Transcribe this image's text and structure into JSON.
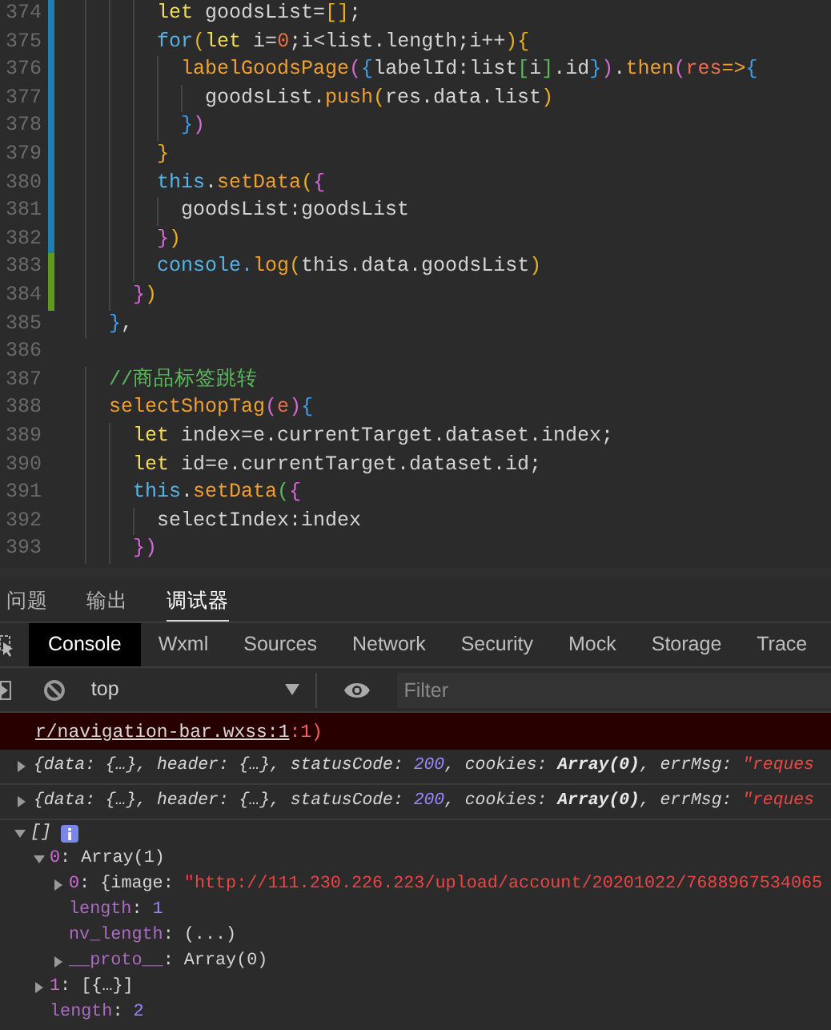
{
  "editor": {
    "lines": [
      {
        "number": "374",
        "modified": true,
        "added": false,
        "tokens": [
          {
            "t": "      let",
            "kind": "decl"
          },
          {
            "t": " goodsList=",
            "kind": "plain"
          },
          {
            "t": "[]",
            "kind": "b1"
          },
          {
            "t": ";",
            "kind": "plain"
          }
        ]
      },
      {
        "number": "375",
        "modified": true,
        "added": false,
        "tokens": [
          {
            "t": "      for",
            "kind": "kw"
          },
          {
            "t": "(",
            "kind": "b1"
          },
          {
            "t": "let",
            "kind": "decl"
          },
          {
            "t": " i=",
            "kind": "plain"
          },
          {
            "t": "0",
            "kind": "num"
          },
          {
            "t": ";i<list.length;i++",
            "kind": "plain"
          },
          {
            "t": "){",
            "kind": "b1"
          }
        ]
      },
      {
        "number": "376",
        "modified": true,
        "added": false,
        "tokens": [
          {
            "t": "        labelGoodsPage",
            "kind": "fn"
          },
          {
            "t": "(",
            "kind": "b2"
          },
          {
            "t": "{",
            "kind": "b3"
          },
          {
            "t": "labelId:list",
            "kind": "plain"
          },
          {
            "t": "[",
            "kind": "b4"
          },
          {
            "t": "i",
            "kind": "plain"
          },
          {
            "t": "]",
            "kind": "b4"
          },
          {
            "t": ".id",
            "kind": "plain"
          },
          {
            "t": "}",
            "kind": "b3"
          },
          {
            "t": ")",
            "kind": "b2"
          },
          {
            "t": ".",
            "kind": "plain"
          },
          {
            "t": "then",
            "kind": "fn"
          },
          {
            "t": "(",
            "kind": "b2"
          },
          {
            "t": "res",
            "kind": "param"
          },
          {
            "t": "=>",
            "kind": "fn"
          },
          {
            "t": "{",
            "kind": "b3"
          }
        ]
      },
      {
        "number": "377",
        "modified": true,
        "added": false,
        "tokens": [
          {
            "t": "          goodsList.",
            "kind": "plain"
          },
          {
            "t": "push",
            "kind": "fn"
          },
          {
            "t": "(",
            "kind": "b1"
          },
          {
            "t": "res.data.list",
            "kind": "plain"
          },
          {
            "t": ")",
            "kind": "b1"
          }
        ]
      },
      {
        "number": "378",
        "modified": true,
        "added": false,
        "tokens": [
          {
            "t": "        }",
            "kind": "b3"
          },
          {
            "t": ")",
            "kind": "b2"
          }
        ]
      },
      {
        "number": "379",
        "modified": true,
        "added": false,
        "tokens": [
          {
            "t": "      }",
            "kind": "b1"
          }
        ]
      },
      {
        "number": "380",
        "modified": true,
        "added": false,
        "tokens": [
          {
            "t": "      this",
            "kind": "kw"
          },
          {
            "t": ".",
            "kind": "plain"
          },
          {
            "t": "setData",
            "kind": "fn"
          },
          {
            "t": "(",
            "kind": "b1"
          },
          {
            "t": "{",
            "kind": "b2"
          }
        ]
      },
      {
        "number": "381",
        "modified": true,
        "added": false,
        "tokens": [
          {
            "t": "        goodsList:goodsList",
            "kind": "plain"
          }
        ]
      },
      {
        "number": "382",
        "modified": true,
        "added": false,
        "tokens": [
          {
            "t": "      }",
            "kind": "b2"
          },
          {
            "t": ")",
            "kind": "b1"
          }
        ]
      },
      {
        "number": "383",
        "modified": false,
        "added": true,
        "tokens": [
          {
            "t": "      console.",
            "kind": "kw"
          },
          {
            "t": "log",
            "kind": "fn"
          },
          {
            "t": "(",
            "kind": "b1"
          },
          {
            "t": "this.data.goodsList",
            "kind": "plain"
          },
          {
            "t": ")",
            "kind": "b1"
          }
        ]
      },
      {
        "number": "384",
        "modified": false,
        "added": true,
        "tokens": [
          {
            "t": "    }",
            "kind": "b2"
          },
          {
            "t": ")",
            "kind": "b1"
          }
        ]
      },
      {
        "number": "385",
        "modified": false,
        "added": false,
        "tokens": [
          {
            "t": "  }",
            "kind": "b3"
          },
          {
            "t": ",",
            "kind": "plain"
          }
        ]
      },
      {
        "number": "386",
        "modified": false,
        "added": false
      },
      {
        "number": "387",
        "modified": false,
        "added": false,
        "tokens": [
          {
            "t": "  //商品标签跳转",
            "kind": "comment"
          }
        ]
      },
      {
        "number": "388",
        "modified": false,
        "added": false,
        "tokens": [
          {
            "t": "  selectShopTag",
            "kind": "fn"
          },
          {
            "t": "(",
            "kind": "b2"
          },
          {
            "t": "e",
            "kind": "param"
          },
          {
            "t": ")",
            "kind": "b2"
          },
          {
            "t": "{",
            "kind": "b3"
          }
        ]
      },
      {
        "number": "389",
        "modified": false,
        "added": false,
        "tokens": [
          {
            "t": "    let",
            "kind": "decl"
          },
          {
            "t": " index=e.currentTarget.dataset.index;",
            "kind": "plain"
          }
        ]
      },
      {
        "number": "390",
        "modified": false,
        "added": false,
        "tokens": [
          {
            "t": "    let",
            "kind": "decl"
          },
          {
            "t": " id=e.currentTarget.dataset.id;",
            "kind": "plain"
          }
        ]
      },
      {
        "number": "391",
        "modified": false,
        "added": false,
        "tokens": [
          {
            "t": "    this",
            "kind": "kw"
          },
          {
            "t": ".",
            "kind": "plain"
          },
          {
            "t": "setData",
            "kind": "fn"
          },
          {
            "t": "(",
            "kind": "b4"
          },
          {
            "t": "{",
            "kind": "b2"
          }
        ]
      },
      {
        "number": "392",
        "modified": false,
        "added": false,
        "tokens": [
          {
            "t": "      selectIndex:index",
            "kind": "plain"
          }
        ]
      },
      {
        "number": "393",
        "modified": false,
        "added": false,
        "tokens": [
          {
            "t": "    }",
            "kind": "b2"
          },
          {
            "t": ")",
            "kind": "b2"
          }
        ]
      }
    ]
  },
  "panel_tabs": [
    {
      "label": "问题",
      "selected": false
    },
    {
      "label": "输出",
      "selected": false
    },
    {
      "label": "调试器",
      "selected": true
    }
  ],
  "devtools_tabs": [
    {
      "label": "Console",
      "selected": true
    },
    {
      "label": "Wxml",
      "selected": false
    },
    {
      "label": "Sources",
      "selected": false
    },
    {
      "label": "Network",
      "selected": false
    },
    {
      "label": "Security",
      "selected": false
    },
    {
      "label": "Mock",
      "selected": false
    },
    {
      "label": "Storage",
      "selected": false
    },
    {
      "label": "Trace",
      "selected": false
    }
  ],
  "toolbar": {
    "context": "top",
    "filter": {
      "placeholder": "Filter"
    }
  },
  "messages": [
    {
      "kind": "error",
      "link": "r/navigation-bar.wxss:1",
      "tokens": [
        {
          "t": ":1",
          "kind": "errnum"
        },
        {
          "t": ")",
          "kind": "err"
        }
      ]
    },
    {
      "kind": "log",
      "expanded": false,
      "tokens": [
        {
          "t": "{data: {…}, header: {…}, statusCode: ",
          "kind": "plain"
        },
        {
          "t": "200",
          "kind": "num"
        },
        {
          "t": ", cookies: ",
          "kind": "plain"
        },
        {
          "t": "Array(0)",
          "kind": "strong"
        },
        {
          "t": ", errMsg: ",
          "kind": "plain"
        },
        {
          "t": "\"reques",
          "kind": "str"
        }
      ]
    },
    {
      "kind": "log",
      "expanded": false,
      "tokens": [
        {
          "t": "{data: {…}, header: {…}, statusCode: ",
          "kind": "plain"
        },
        {
          "t": "200",
          "kind": "num"
        },
        {
          "t": ", cookies: ",
          "kind": "plain"
        },
        {
          "t": "Array(0)",
          "kind": "strong"
        },
        {
          "t": ", errMsg: ",
          "kind": "plain"
        },
        {
          "t": "\"reques",
          "kind": "str"
        }
      ]
    },
    {
      "kind": "tree",
      "node": {
        "expanded": true,
        "info": true,
        "tokens": [
          {
            "t": "[]",
            "kind": "italic"
          }
        ],
        "children": [
          {
            "expanded": true,
            "tokens": [
              {
                "t": "0",
                "kind": "idx"
              },
              {
                "t": ": Array(1)",
                "kind": "plain"
              }
            ],
            "children": [
              {
                "expanded": false,
                "tokens": [
                  {
                    "t": "0",
                    "kind": "idx"
                  },
                  {
                    "t": ": {image: ",
                    "kind": "plain"
                  },
                  {
                    "t": "\"http://111.230.226.223/upload/account/20201022/7688967534065",
                    "kind": "str"
                  }
                ]
              },
              {
                "tokens": [
                  {
                    "t": "length",
                    "kind": "key"
                  },
                  {
                    "t": ": ",
                    "kind": "plain"
                  },
                  {
                    "t": "1",
                    "kind": "num"
                  }
                ]
              },
              {
                "tokens": [
                  {
                    "t": "nv_length",
                    "kind": "key"
                  },
                  {
                    "t": ": (...)",
                    "kind": "plain"
                  }
                ]
              },
              {
                "expanded": false,
                "tokens": [
                  {
                    "t": "__proto__",
                    "kind": "key"
                  },
                  {
                    "t": ": Array(0)",
                    "kind": "plain"
                  }
                ]
              }
            ]
          },
          {
            "expanded": false,
            "tokens": [
              {
                "t": "1",
                "kind": "idx"
              },
              {
                "t": ": [{…}]",
                "kind": "plain"
              }
            ]
          },
          {
            "tokens": [
              {
                "t": "length",
                "kind": "key"
              },
              {
                "t": ": ",
                "kind": "plain"
              },
              {
                "t": "2",
                "kind": "num"
              }
            ]
          }
        ]
      }
    }
  ]
}
